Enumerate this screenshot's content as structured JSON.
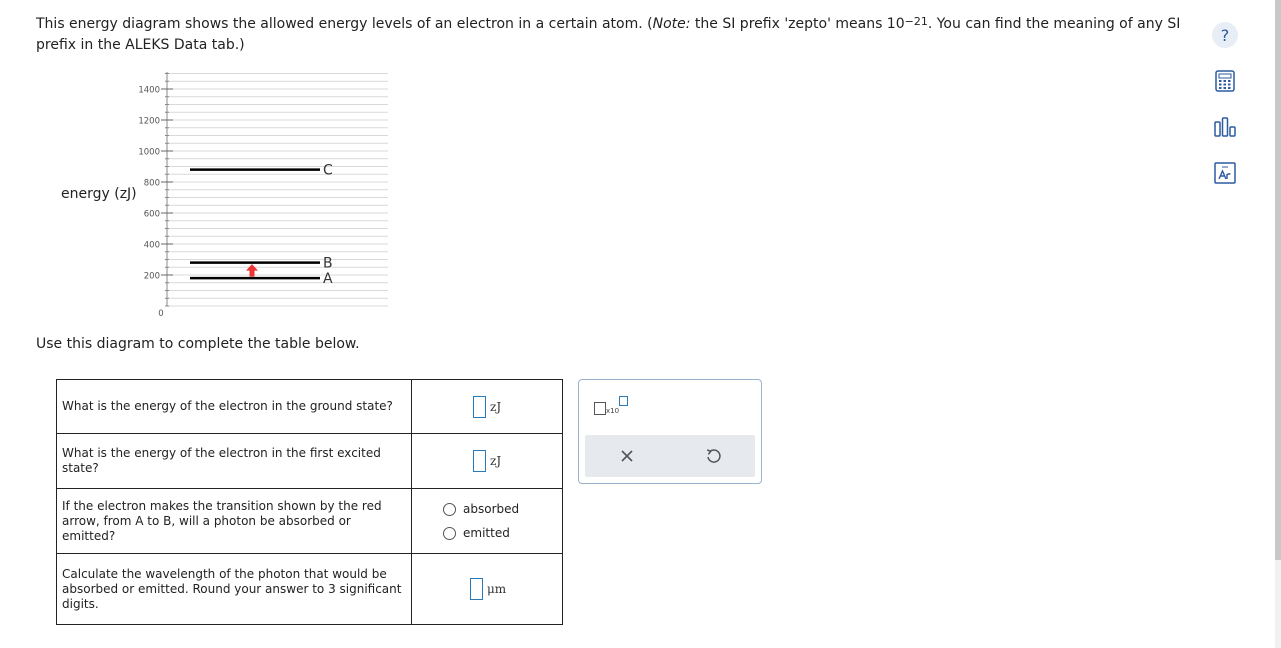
{
  "intro": {
    "part1": "This energy diagram shows the allowed energy levels of an electron in a certain atom. (",
    "note_label": "Note:",
    "part2": " the SI prefix 'zepto' means 10",
    "exponent": "−21",
    "part3": ". You can find the meaning of any SI prefix in the ALEKS Data tab.)"
  },
  "diagram": {
    "ylabel": "energy (zJ)",
    "ticks": [
      "0",
      "200",
      "400",
      "600",
      "800",
      "1000",
      "1200",
      "1400"
    ],
    "levels": [
      {
        "label": "A",
        "energy": 180
      },
      {
        "label": "B",
        "energy": 280
      },
      {
        "label": "C",
        "energy": 880
      }
    ],
    "transition": {
      "from": "A",
      "to": "B",
      "color": "#ee3333"
    }
  },
  "instruction": "Use this diagram to complete the table below.",
  "table": {
    "q1": "What is the energy of the electron in the ground state?",
    "q1_unit": "zJ",
    "q2": "What is the energy of the electron in the first excited state?",
    "q2_unit": "zJ",
    "q3": "If the electron makes the transition shown by the red arrow, from A to B, will a photon be absorbed or emitted?",
    "q3_opt1": "absorbed",
    "q3_opt2": "emitted",
    "q4": "Calculate the wavelength of the photon that would be absorbed or emitted. Round your answer to 3 significant digits.",
    "q4_unit": "μm"
  },
  "panel": {
    "x10_label": "x10"
  },
  "tools": {
    "help": "?"
  },
  "colors": {
    "accent": "#2a7ab8",
    "arrow": "#ee3333"
  }
}
